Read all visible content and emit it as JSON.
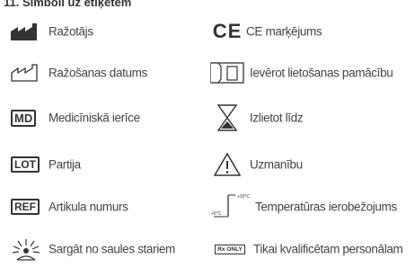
{
  "heading": "11. Simboli uz etiķetēm",
  "left": [
    {
      "icon": "manufacturer-icon",
      "label": "Ražotājs"
    },
    {
      "icon": "manufacture-date-icon",
      "label": "Ražošanas datums"
    },
    {
      "icon": "md-icon",
      "icon_text": "MD",
      "label": "Medicīniskā ierīce"
    },
    {
      "icon": "lot-icon",
      "icon_text": "LOT",
      "label": "Partija"
    },
    {
      "icon": "ref-icon",
      "icon_text": "REF",
      "label": "Artikula numurs"
    },
    {
      "icon": "sunlight-icon",
      "label": "Sargāt no saules stariem"
    }
  ],
  "right": [
    {
      "icon": "ce-mark-icon",
      "icon_text": "CE",
      "label": "CE marķējums"
    },
    {
      "icon": "instructions-icon",
      "icon_text": "i",
      "label": "Ievērot lietošanas pamācību"
    },
    {
      "icon": "hourglass-icon",
      "label": "Izlietot līdz"
    },
    {
      "icon": "caution-icon",
      "label": "Uzmanību"
    },
    {
      "icon": "temperature-icon",
      "icon_text_high": "+30°C",
      "icon_text_low": "+5°C",
      "label": "Temperatūras ierobežojums"
    },
    {
      "icon": "rx-only-icon",
      "icon_text": "Rx ONLY",
      "label": "Tikai kvalificētam personālam"
    }
  ]
}
